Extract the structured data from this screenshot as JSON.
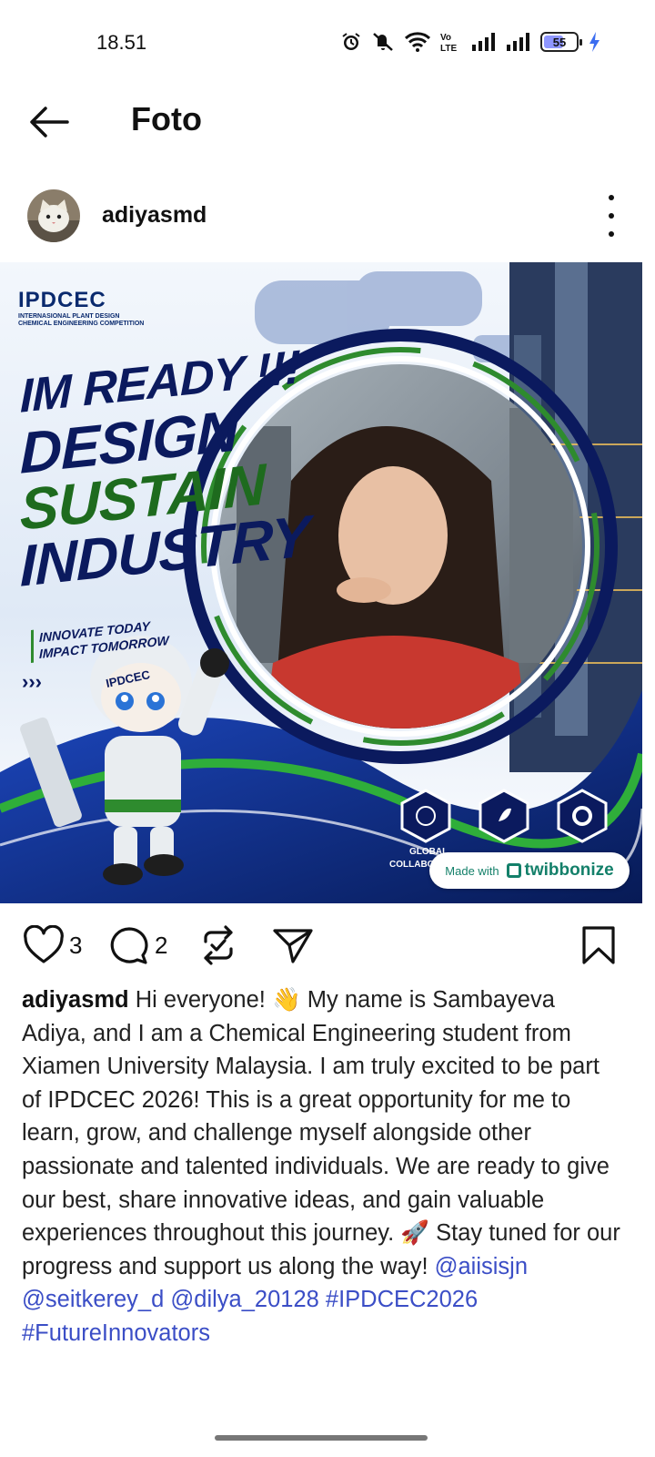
{
  "status_bar": {
    "time": "18.51",
    "battery_level": "55",
    "icons": [
      "alarm-icon",
      "mute-icon",
      "wifi-icon",
      "volte-icon",
      "signal-icon",
      "signal-icon",
      "battery-icon",
      "charging-icon"
    ]
  },
  "app_bar": {
    "title": "Foto"
  },
  "post": {
    "username": "adiyasmd",
    "image": {
      "brand_name": "IPDCEC",
      "brand_sub_1": "INTERNASIONAL PLANT DESIGN",
      "brand_sub_2": "CHEMICAL ENGINEERING COMPETITION",
      "headline_1": "IM READY !!!",
      "headline_2": "DESIGN",
      "headline_3": "SUSTAIN",
      "headline_4": "INDUSTRY",
      "tagline_1": "INNOVATE TODAY",
      "tagline_2": "IMPACT TOMORROW",
      "arrows": "›››",
      "mascot_badge": "IPDCEC",
      "feature_1": "GLOBAL",
      "feature_1b": "COLLABO",
      "made_with_label": "Made with",
      "made_with_brand": "twibbonize"
    },
    "likes": "3",
    "comments": "2",
    "caption_user": "adiyasmd",
    "caption_text": " Hi everyone! 👋 My name is Sambayeva Adiya, and I am a Chemical Engineering student from Xiamen University Malaysia. I am truly excited to be part of IPDCEC 2026! This is a great opportunity for me to learn, grow, and challenge myself alongside other passionate and talented individuals. We are ready to give our best, share innovative ideas, and gain valuable experiences throughout this journey. 🚀 Stay tuned for our progress and support us along the way! ",
    "mentions": [
      "@aiisisjn",
      "@seitkerey_d",
      "@dilya_20128"
    ],
    "hashtags": [
      "#IPDCEC2026",
      "#FutureInnovators"
    ]
  },
  "colors": {
    "link": "#3b4ec6",
    "navy": "#0b1a5e",
    "green": "#1e6b1e"
  }
}
